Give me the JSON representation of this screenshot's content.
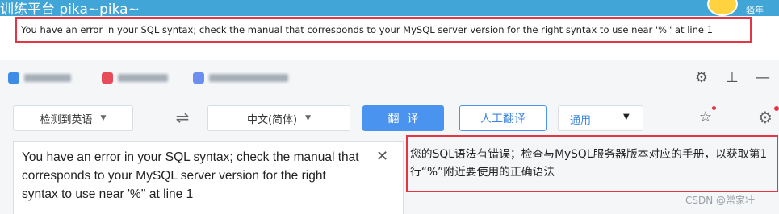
{
  "site": {
    "title": "训练平台 pika~pika~",
    "username": "骚年"
  },
  "error": {
    "message": "You have an error in your SQL syntax; check the manual that corresponds to your MySQL server version for the right syntax to use near '%'' at line 1"
  },
  "translator": {
    "source_lang": "检测到英语",
    "target_lang": "中文(简体)",
    "translate_button": "翻译",
    "human_translate_button": "人工翻译",
    "domain_select": "通用",
    "source_text": "You have an error in your SQL syntax; check the manual that corresponds to your MySQL server version for the right syntax to use near '%'' at line 1",
    "target_text": "您的SQL语法有错误；检查与MySQL服务器版本对应的手册，以获取第1行“%”附近要使用的正确语法"
  },
  "watermark": "CSDN @常家壮",
  "icons": [
    "settings-icon",
    "pin-icon",
    "minimize-icon",
    "swap-icon",
    "favorite-icon",
    "gear-icon",
    "clear-icon"
  ]
}
